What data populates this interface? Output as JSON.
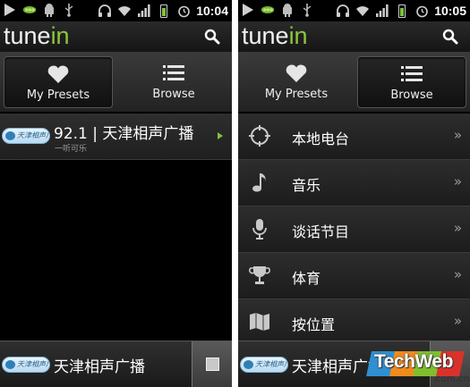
{
  "screens": [
    {
      "status_time": "10:04",
      "logo_main": "tune",
      "logo_accent": "in",
      "active_tab": "presets",
      "tabs": {
        "presets_label": "My Presets",
        "browse_label": "Browse"
      },
      "preset": {
        "title": "92.1 | 天津相声广播",
        "subtitle": "一听可乐",
        "logo_text": "天津相声广播"
      },
      "now_playing": {
        "title": "天津相声广播",
        "logo_text": "天津相声广播"
      }
    },
    {
      "status_time": "10:05",
      "logo_main": "tune",
      "logo_accent": "in",
      "active_tab": "browse",
      "tabs": {
        "presets_label": "My Presets",
        "browse_label": "Browse"
      },
      "menu": [
        {
          "label": "本地电台",
          "icon": "location-crosshair-icon",
          "chevron": "»"
        },
        {
          "label": "音乐",
          "icon": "music-note-icon",
          "chevron": "»"
        },
        {
          "label": "谈话节目",
          "icon": "microphone-icon",
          "chevron": "»"
        },
        {
          "label": "体育",
          "icon": "trophy-icon",
          "chevron": "»"
        },
        {
          "label": "按位置",
          "icon": "map-icon",
          "chevron": "»"
        }
      ],
      "now_playing": {
        "title": "天津相声广播",
        "logo_text": "天津相声广播"
      }
    }
  ],
  "watermark": {
    "brand": "TechWeb",
    "domain": ".com.cn"
  },
  "colors": {
    "accent": "#8ec63f",
    "background": "#000000",
    "list_bg": "#262626",
    "chevron": "#9c9c9c"
  }
}
